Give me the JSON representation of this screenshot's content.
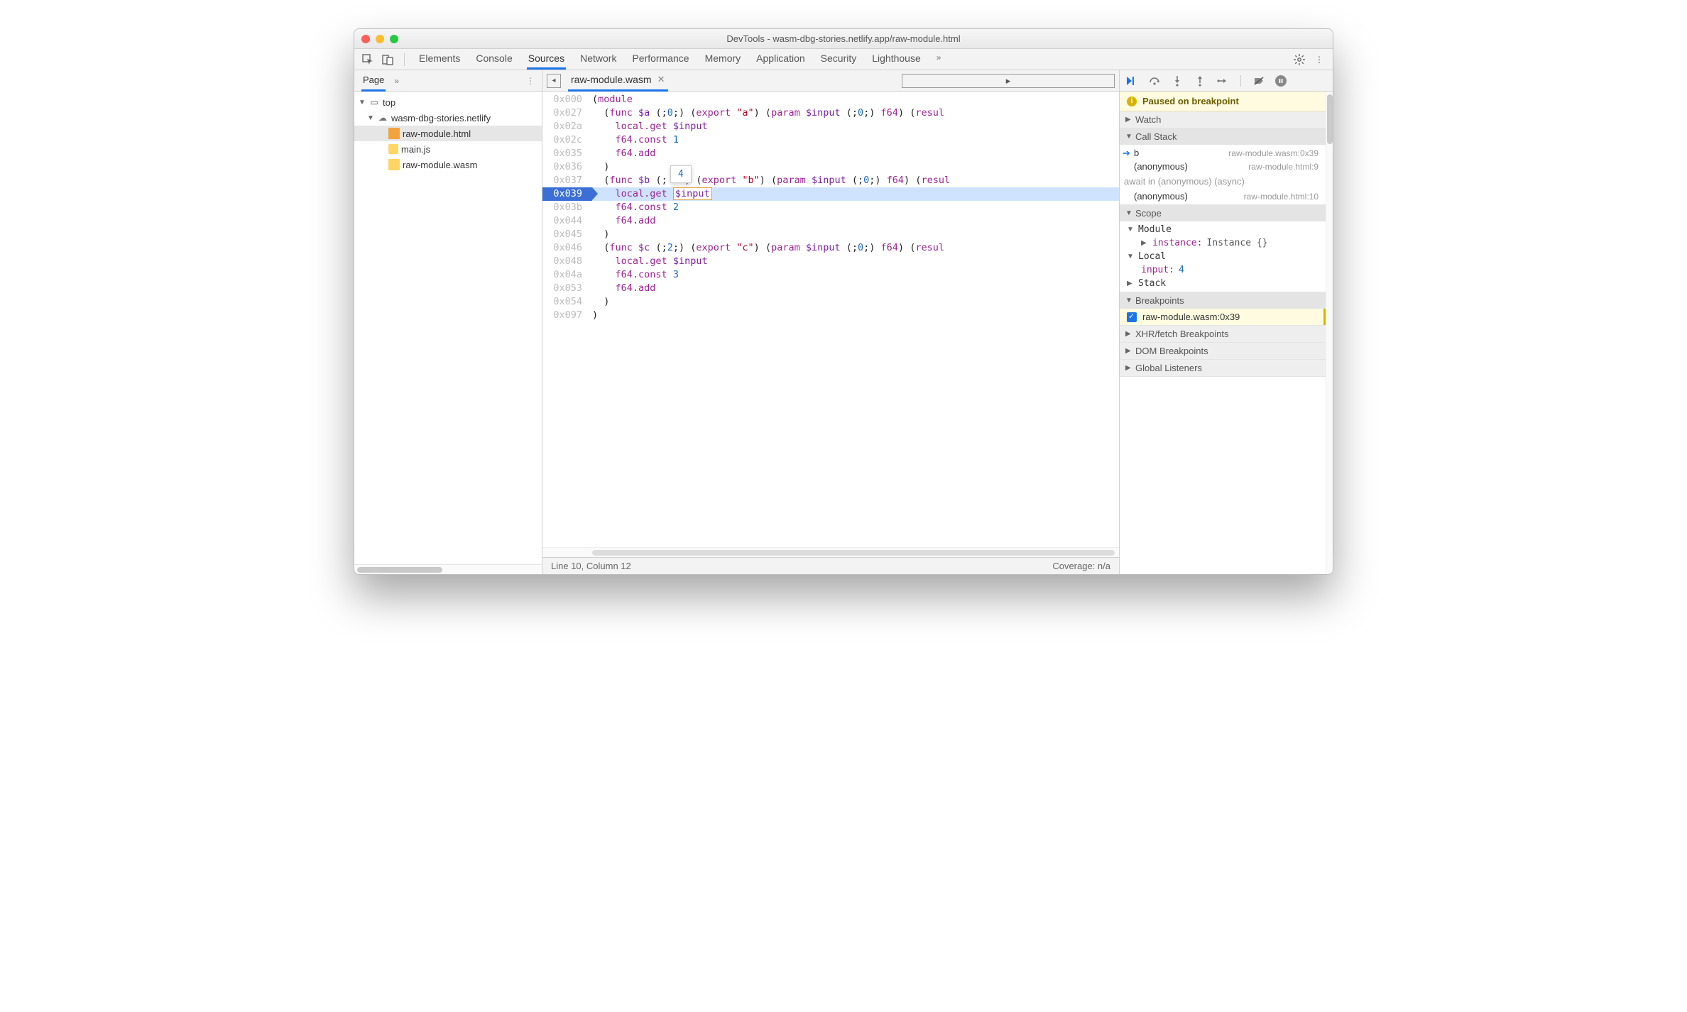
{
  "window": {
    "title": "DevTools - wasm-dbg-stories.netlify.app/raw-module.html"
  },
  "toolbar": {
    "tabs": [
      "Elements",
      "Console",
      "Sources",
      "Network",
      "Performance",
      "Memory",
      "Application",
      "Security",
      "Lighthouse"
    ],
    "activeTab": "Sources",
    "more": "»"
  },
  "left": {
    "pageTab": "Page",
    "more": "»",
    "tree": {
      "top": "top",
      "domain": "wasm-dbg-stories.netlify",
      "files": [
        {
          "name": "raw-module.html",
          "type": "html",
          "selected": true
        },
        {
          "name": "main.js",
          "type": "js"
        },
        {
          "name": "raw-module.wasm",
          "type": "wasm"
        }
      ]
    }
  },
  "center": {
    "fileTab": "raw-module.wasm",
    "tooltip": "4",
    "cursorHighlight": "$input",
    "lines": [
      {
        "addr": "0x000",
        "dim": true,
        "tokens": [
          [
            "pn",
            "("
          ],
          [
            "kw",
            "module"
          ]
        ]
      },
      {
        "addr": "0x027",
        "tokens": [
          [
            "pn",
            "  ("
          ],
          [
            "kw",
            "func"
          ],
          [
            "pn",
            " "
          ],
          [
            "var",
            "$a"
          ],
          [
            "pn",
            " (;"
          ],
          [
            "num",
            "0"
          ],
          [
            "pn",
            ";) ("
          ],
          [
            "kw",
            "export"
          ],
          [
            "pn",
            " "
          ],
          [
            "str",
            "\"a\""
          ],
          [
            "pn",
            ") ("
          ],
          [
            "kw",
            "param"
          ],
          [
            "pn",
            " "
          ],
          [
            "var",
            "$input"
          ],
          [
            "pn",
            " (;"
          ],
          [
            "num",
            "0"
          ],
          [
            "pn",
            ";) "
          ],
          [
            "kw",
            "f64"
          ],
          [
            "pn",
            ") ("
          ],
          [
            "kw",
            "resul"
          ]
        ]
      },
      {
        "addr": "0x02a",
        "tokens": [
          [
            "pn",
            "    "
          ],
          [
            "kw",
            "local.get"
          ],
          [
            "pn",
            " "
          ],
          [
            "var",
            "$input"
          ]
        ]
      },
      {
        "addr": "0x02c",
        "tokens": [
          [
            "pn",
            "    "
          ],
          [
            "kw",
            "f64.const"
          ],
          [
            "pn",
            " "
          ],
          [
            "num",
            "1"
          ]
        ]
      },
      {
        "addr": "0x035",
        "tokens": [
          [
            "pn",
            "    "
          ],
          [
            "kw",
            "f64.add"
          ]
        ]
      },
      {
        "addr": "0x036",
        "tokens": [
          [
            "pn",
            "  )"
          ]
        ]
      },
      {
        "addr": "0x037",
        "tokens": [
          [
            "pn",
            "  ("
          ],
          [
            "kw",
            "func"
          ],
          [
            "pn",
            " "
          ],
          [
            "var",
            "$b"
          ],
          [
            "pn",
            " (;   ) ("
          ],
          [
            "kw",
            "export"
          ],
          [
            "pn",
            " "
          ],
          [
            "str",
            "\"b\""
          ],
          [
            "pn",
            ") ("
          ],
          [
            "kw",
            "param"
          ],
          [
            "pn",
            " "
          ],
          [
            "var",
            "$input"
          ],
          [
            "pn",
            " (;"
          ],
          [
            "num",
            "0"
          ],
          [
            "pn",
            ";) "
          ],
          [
            "kw",
            "f64"
          ],
          [
            "pn",
            ") ("
          ],
          [
            "kw",
            "resul"
          ]
        ]
      },
      {
        "addr": "0x039",
        "hl": true,
        "tokens": [
          [
            "pn",
            "    "
          ],
          [
            "kw",
            "local.get"
          ],
          [
            "pn",
            " "
          ]
        ]
      },
      {
        "addr": "0x03b",
        "tokens": [
          [
            "pn",
            "    "
          ],
          [
            "kw",
            "f64.const"
          ],
          [
            "pn",
            " "
          ],
          [
            "num",
            "2"
          ]
        ]
      },
      {
        "addr": "0x044",
        "tokens": [
          [
            "pn",
            "    "
          ],
          [
            "kw",
            "f64.add"
          ]
        ]
      },
      {
        "addr": "0x045",
        "tokens": [
          [
            "pn",
            "  )"
          ]
        ]
      },
      {
        "addr": "0x046",
        "dim": true,
        "tokens": [
          [
            "pn",
            "  ("
          ],
          [
            "kw",
            "func"
          ],
          [
            "pn",
            " "
          ],
          [
            "var",
            "$c"
          ],
          [
            "pn",
            " (;"
          ],
          [
            "num",
            "2"
          ],
          [
            "pn",
            ";) ("
          ],
          [
            "kw",
            "export"
          ],
          [
            "pn",
            " "
          ],
          [
            "str",
            "\"c\""
          ],
          [
            "pn",
            ") ("
          ],
          [
            "kw",
            "param"
          ],
          [
            "pn",
            " "
          ],
          [
            "var",
            "$input"
          ],
          [
            "pn",
            " (;"
          ],
          [
            "num",
            "0"
          ],
          [
            "pn",
            ";) "
          ],
          [
            "kw",
            "f64"
          ],
          [
            "pn",
            ") ("
          ],
          [
            "kw",
            "resul"
          ]
        ]
      },
      {
        "addr": "0x048",
        "tokens": [
          [
            "pn",
            "    "
          ],
          [
            "kw",
            "local.get"
          ],
          [
            "pn",
            " "
          ],
          [
            "var",
            "$input"
          ]
        ]
      },
      {
        "addr": "0x04a",
        "tokens": [
          [
            "pn",
            "    "
          ],
          [
            "kw",
            "f64.const"
          ],
          [
            "pn",
            " "
          ],
          [
            "num",
            "3"
          ]
        ]
      },
      {
        "addr": "0x053",
        "tokens": [
          [
            "pn",
            "    "
          ],
          [
            "kw",
            "f64.add"
          ]
        ]
      },
      {
        "addr": "0x054",
        "tokens": [
          [
            "pn",
            "  )"
          ]
        ]
      },
      {
        "addr": "0x097",
        "dim": true,
        "tokens": [
          [
            "pn",
            ")"
          ]
        ]
      }
    ],
    "status": {
      "left": "Line 10, Column 12",
      "right": "Coverage: n/a"
    }
  },
  "right": {
    "banner": "Paused on breakpoint",
    "sections": {
      "watch": "Watch",
      "callstack": "Call Stack",
      "scope": "Scope",
      "breakpoints": "Breakpoints",
      "xhr": "XHR/fetch Breakpoints",
      "dom": "DOM Breakpoints",
      "global": "Global Listeners"
    },
    "callstack": [
      {
        "name": "b",
        "loc": "raw-module.wasm:0x39",
        "current": true
      },
      {
        "name": "(anonymous)",
        "loc": "raw-module.html:9"
      }
    ],
    "asyncLabel": "await in (anonymous) (async)",
    "callstack2": [
      {
        "name": "(anonymous)",
        "loc": "raw-module.html:10"
      }
    ],
    "scope": {
      "module": {
        "label": "Module",
        "instanceKey": "instance:",
        "instanceVal": "Instance {}"
      },
      "local": {
        "label": "Local",
        "inputKey": "input:",
        "inputVal": "4"
      },
      "stack": "Stack"
    },
    "breakpoint": "raw-module.wasm:0x39"
  }
}
